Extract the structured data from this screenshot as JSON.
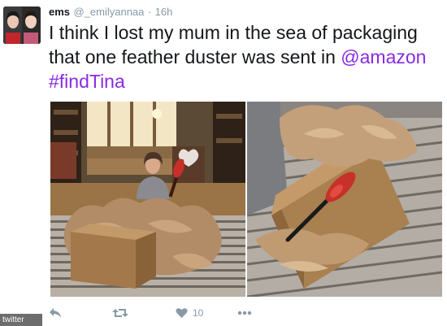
{
  "user": {
    "display_name": "ems",
    "handle": "@_emilyannaa",
    "separator": "·",
    "time": "16h"
  },
  "tweet": {
    "text_plain": "I think I lost my mum in the sea of packaging that one feather duster was sent in ",
    "mention": "@amazon",
    "space": " ",
    "hashtag": "#findTina"
  },
  "actions": {
    "like_count": "10"
  },
  "icons": {
    "reply": "reply-icon",
    "retweet": "retweet-icon",
    "like": "heart-icon",
    "more": "more-dots-icon"
  },
  "watermark": {
    "text": "twitter"
  },
  "colors": {
    "link": "#8a2be2",
    "meta": "#8899a6"
  }
}
